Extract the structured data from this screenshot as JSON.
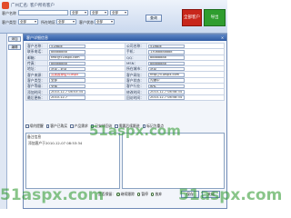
{
  "toolbar": {
    "title": "广州汇名: 客户所有客户",
    "label_customer": "客户名称",
    "select_a": "全部",
    "select_b": "全部",
    "select_c": "全部",
    "label_type": "客户类型",
    "select_type": "全部",
    "label_region": "所在地区",
    "select_region": "全部",
    "label_status": "客户状态",
    "select_status": "全部",
    "btn_search": "查询",
    "btn_hidden": "全部客户",
    "btn_export": "导出"
  },
  "leftnav": {
    "btn1": "添加",
    "btn2": "编辑"
  },
  "dialog": {
    "title": "客户详细信息",
    "close": "×",
    "rows": [
      {
        "l1": "客户名称：",
        "v1": "51aspx",
        "l2": "公司名称：",
        "v2": "51aspx"
      },
      {
        "l1": "联系电话：",
        "v1": "88888888",
        "l2": "手机：",
        "v2": "13088888888"
      },
      {
        "l1": "邮箱：",
        "v1": "test@51aspx.com",
        "l2": "QQ：",
        "v2": "88888888"
      },
      {
        "l1": "传真：",
        "v1": "88888888",
        "l2": "MSN：",
        "v2": "88888888"
      },
      {
        "l1": "地址：",
        "v1": "北京 - 北京",
        "l2": "所在城市：",
        "v2": "北京"
      },
      {
        "l1": "客户来源：",
        "v1": "点我推荐给51aspx",
        "l2": "客户网址：",
        "v2": "http://51aspx.com"
      },
      {
        "l1": "客户类型：",
        "v1": "全部",
        "l2": "客户状态：",
        "v2": "沟通中"
      },
      {
        "l1": "客户等级：",
        "v1": "全部",
        "l2": "客户行业：",
        "v2": "软件"
      },
      {
        "l1": "添加时间：",
        "v1": "2010-12-7 08:53:34",
        "l2": "修改时间：",
        "v2": "2010-12-7 08:58:34"
      },
      {
        "l1": "最后更新：",
        "v1": "2010-12-7",
        "l2": "回访时间：",
        "v2": "2010-12-7 08:58:34"
      }
    ],
    "checks": [
      "续约提醒",
      "客户已购买",
      "产品需求",
      "已安排回访",
      "需要后续跟进",
      "标记为重点"
    ],
    "notes_title": "备注信息",
    "notes_text": "添加客户于2010-12-07 08:53:34",
    "radio_label": "是否保留：",
    "radios": [
      "继续跟踪",
      "暂停",
      "放弃"
    ],
    "btn_save": "保存",
    "btn_close": "关闭"
  },
  "watermarks": [
    "51aspx.com",
    "51aspx.com",
    "51aspx.com"
  ],
  "colors": {
    "header_blue": "#2d5aa4",
    "hidden_red": "#c8261b",
    "watermark_green": "#2f9d2f"
  }
}
